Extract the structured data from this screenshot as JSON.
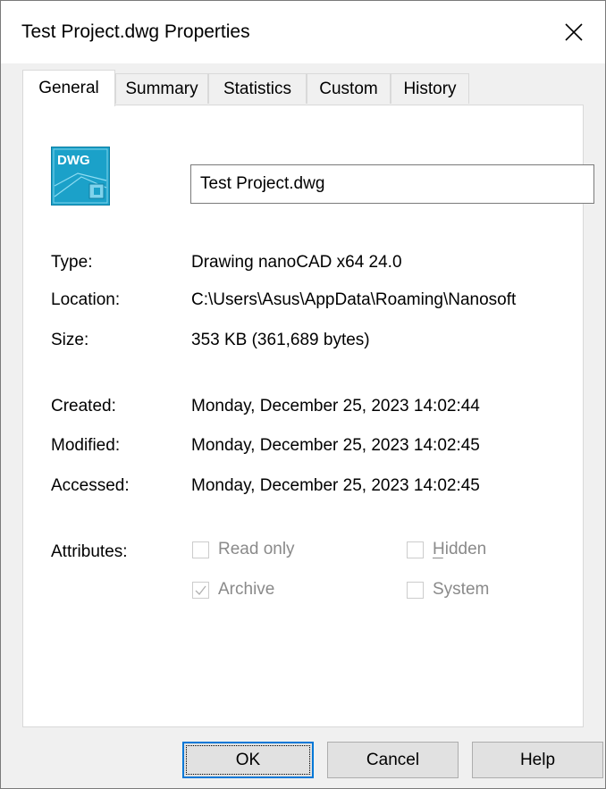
{
  "window": {
    "title": "Test Project.dwg Properties"
  },
  "tabs": [
    {
      "label": "General",
      "active": true
    },
    {
      "label": "Summary",
      "active": false
    },
    {
      "label": "Statistics",
      "active": false
    },
    {
      "label": "Custom",
      "active": false
    },
    {
      "label": "History",
      "active": false
    }
  ],
  "general": {
    "icon": {
      "name": "dwg-file-icon",
      "text": "DWG",
      "color": "#1ba1c9"
    },
    "file_name": "Test Project.dwg",
    "fields": {
      "type": {
        "label": "Type:",
        "value": "Drawing nanoCAD x64 24.0"
      },
      "location": {
        "label": "Location:",
        "value": "C:\\Users\\Asus\\AppData\\Roaming\\Nanosoft"
      },
      "size": {
        "label": "Size:",
        "value": "353 KB (361,689 bytes)"
      },
      "created": {
        "label": "Created:",
        "value": "Monday, December 25, 2023 14:02:44"
      },
      "modified": {
        "label": "Modified:",
        "value": "Monday, December 25, 2023 14:02:45"
      },
      "accessed": {
        "label": "Accessed:",
        "value": "Monday, December 25, 2023 14:02:45"
      }
    },
    "attributes": {
      "label": "Attributes:",
      "read_only": {
        "label": "Read only",
        "checked": false
      },
      "hidden": {
        "label": "Hidden",
        "checked": false
      },
      "archive": {
        "label": "Archive",
        "checked": true
      },
      "system": {
        "label": "System",
        "checked": false
      }
    }
  },
  "buttons": {
    "ok": "OK",
    "cancel": "Cancel",
    "help": "Help"
  },
  "colors": {
    "accent": "#0078d7",
    "dialog_bg": "#f0f0f0",
    "disabled_text": "#8a8a8a"
  }
}
